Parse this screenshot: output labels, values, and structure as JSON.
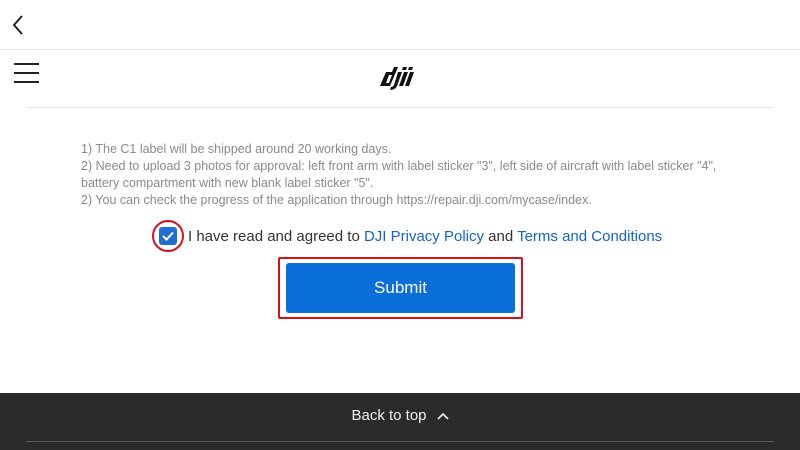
{
  "topbar": {
    "back_icon": "chevron-left-icon"
  },
  "header": {
    "menu_icon": "hamburger-menu-icon",
    "logo_text": "dji"
  },
  "notes": [
    "1) The C1 label will be shipped around 20 working days.",
    "2) Need to upload 3 photos for approval: left front arm with label sticker \"3\", left side of aircraft with label sticker \"4\", battery compartment with new blank label sticker \"5\".",
    "2) You can check the progress of the application through https://repair.dji.com/mycase/index."
  ],
  "agreement": {
    "checked": true,
    "prefix": "I have read and agreed to ",
    "privacy_link": "DJI Privacy Policy",
    "conjunction": " and ",
    "terms_link": "Terms and Conditions"
  },
  "submit": {
    "label": "Submit"
  },
  "footer": {
    "back_to_top": "Back to top"
  },
  "colors": {
    "accent": "#0b6fd9",
    "link": "#1364c7",
    "highlight": "#d6111c",
    "footer_bg": "#2b2b2b"
  }
}
